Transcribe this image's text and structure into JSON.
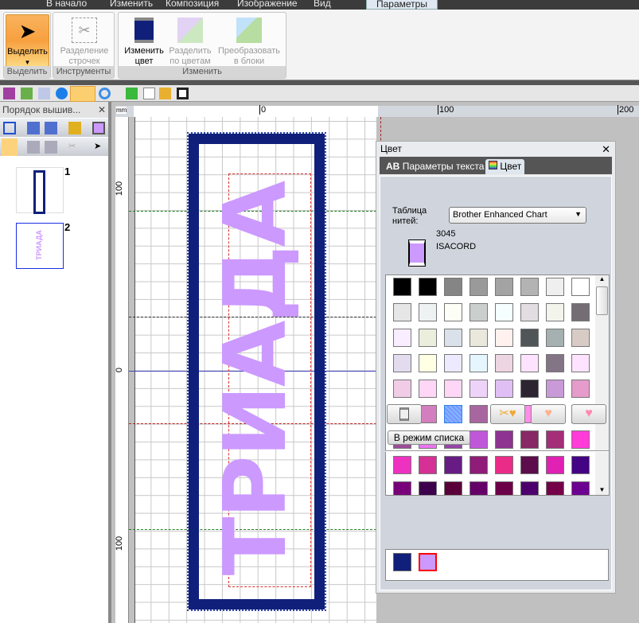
{
  "ribbon_tabs": [
    "В начало",
    "Изменить",
    "Композиция",
    "Изображение",
    "Вид",
    "Параметры"
  ],
  "active_tab": "Параметры",
  "groups": {
    "select": {
      "label": "Выделить",
      "button": "Выделить"
    },
    "tools": {
      "label": "Инструменты",
      "button_line1": "Разделение",
      "button_line2": "строчек"
    },
    "change": {
      "label": "Изменить",
      "change_color1": "Изменить",
      "change_color2": "цвет",
      "split1": "Разделить",
      "split2": "по цветам",
      "convert1": "Преобразовать",
      "convert2": "в блоки"
    }
  },
  "left_panel": {
    "title": "Порядок вышив...",
    "items": [
      {
        "num": "1"
      },
      {
        "num": "2",
        "label": "ТРИАДА"
      }
    ]
  },
  "ruler": {
    "unit": "mm",
    "top": [
      "0",
      "100",
      "200"
    ],
    "left": [
      "100",
      "0",
      "100"
    ]
  },
  "design": {
    "text": "ТРИАДА",
    "frame_color": "#10207a",
    "text_color": "#cc99ff"
  },
  "color_panel": {
    "title": "Цвет",
    "tabs": [
      "Параметры текста",
      "Цвет"
    ],
    "table_label": "Таблица нитей:",
    "table_value": "Brother Enhanced Chart",
    "thread_code": "3045",
    "thread_brand": "ISACORD",
    "thread_color": "#cc99ff",
    "list_mode_button": "В режим списка",
    "selected_swatch": [
      5,
      2
    ],
    "palette": [
      [
        "#000000",
        "#000000",
        "#858585",
        "#9a9a9a",
        "#a3a3a3",
        "#b3b3b3",
        "#efefef",
        "#ffffff"
      ],
      [
        "#e6e6e6",
        "#eef2f2",
        "#fdfef6",
        "#cacfcd",
        "#f5ffff",
        "#e2dde1",
        "#f3f4ec",
        "#746e74"
      ],
      [
        "#f8eeff",
        "#eceedd",
        "#dbe1ea",
        "#eae8dc",
        "#fff2ee",
        "#505557",
        "#a5b1b1",
        "#d8cbc6"
      ],
      [
        "#e3dcef",
        "#ffffe4",
        "#ede9ff",
        "#e5f6ff",
        "#eed5e2",
        "#fde3ff",
        "#837585",
        "#fde3ff"
      ],
      [
        "#f0cce6",
        "#fed6f6",
        "#fed6f6",
        "#eed3f8",
        "#e0c0f4",
        "#2c2430",
        "#c89ad8",
        "#e59cca"
      ],
      [
        "#d891bb",
        "#d27ebf",
        "#7fb8ff",
        "#a866a0",
        "#b074c8",
        "#ff8de9",
        "#915fae",
        "#dc89fb"
      ],
      [
        "#9c4c98",
        "#ec74f0",
        "#9546a8",
        "#c057d9",
        "#8f3390",
        "#882865",
        "#a42e78",
        "#ff3bd8"
      ],
      [
        "#ee32c0",
        "#d43095",
        "#671c84",
        "#8e1c78",
        "#eb2b88",
        "#5d0c4c",
        "#e120b4",
        "#440284"
      ],
      [
        "#780078",
        "#3c004c",
        "#5a0038",
        "#640068",
        "#6c0048",
        "#4c006c",
        "#740048",
        "#6c0090"
      ]
    ],
    "used_colors": [
      "#10207a",
      "#cc99ff"
    ]
  }
}
